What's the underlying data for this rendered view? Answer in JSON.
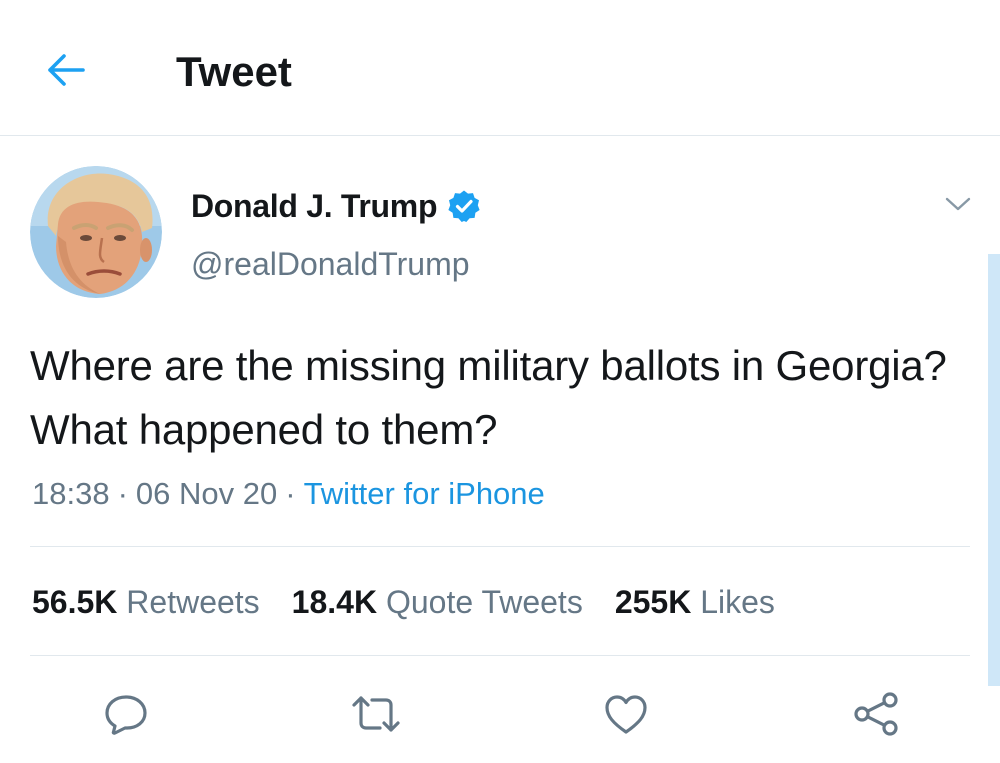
{
  "header": {
    "title": "Tweet",
    "back_icon": "arrow-left-icon"
  },
  "tweet": {
    "author": {
      "name": "Donald J. Trump",
      "handle": "@realDonaldTrump",
      "verified": true
    },
    "text": "Where are the missing military ballots in Georgia? What happened to them?",
    "time": "18:38",
    "date": "06 Nov 20",
    "source": "Twitter for iPhone",
    "separator": "·",
    "stats": {
      "retweets_count": "56.5K",
      "retweets_label": "Retweets",
      "quotes_count": "18.4K",
      "quotes_label": "Quote Tweets",
      "likes_count": "255K",
      "likes_label": "Likes"
    }
  },
  "actions": [
    "reply-icon",
    "retweet-icon",
    "like-icon",
    "share-icon"
  ],
  "colors": {
    "accent": "#1da1f2",
    "link": "#1b95e0",
    "text_primary": "#14171a",
    "text_secondary": "#657786",
    "divider": "#e1e8ed"
  }
}
